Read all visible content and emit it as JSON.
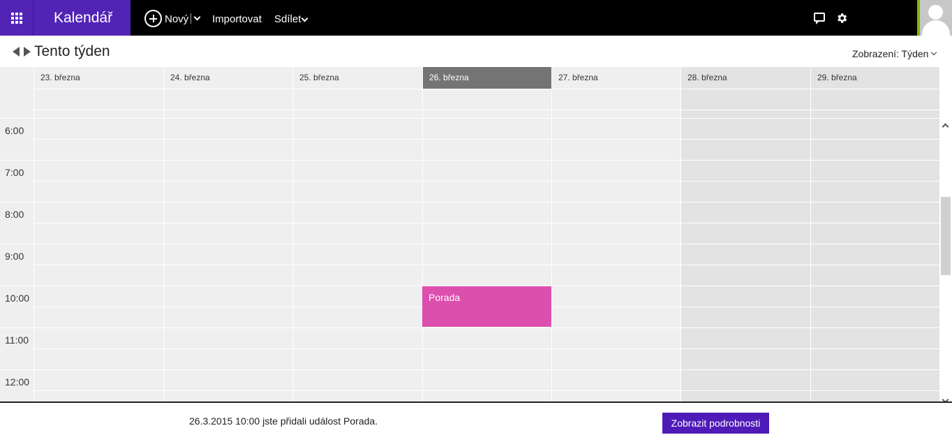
{
  "app": {
    "title": "Kalendář",
    "brand_color": "#5224b6",
    "waffle_icon": "waffle-icon"
  },
  "toolbar": {
    "new_label": "Nový",
    "import_label": "Importovat",
    "share_label": "Sdílet",
    "username": "          ",
    "icons": [
      "plus-circle-icon",
      "chat-icon",
      "gear-icon",
      "avatar"
    ]
  },
  "subheader": {
    "period_title": "Tento týden",
    "view_label": "Zobrazení: Týden"
  },
  "days": [
    {
      "label": "23. března",
      "today": false,
      "weekend": false
    },
    {
      "label": "24. března",
      "today": false,
      "weekend": false
    },
    {
      "label": "25. března",
      "today": false,
      "weekend": false
    },
    {
      "label": "26. března",
      "today": true,
      "weekend": false
    },
    {
      "label": "27. března",
      "today": false,
      "weekend": false
    },
    {
      "label": "28. března",
      "today": false,
      "weekend": true
    },
    {
      "label": "29. března",
      "today": false,
      "weekend": true
    }
  ],
  "hours": [
    "6:00",
    "7:00",
    "8:00",
    "9:00",
    "10:00",
    "11:00",
    "12:00"
  ],
  "events": [
    {
      "title": "Porada",
      "day": "26. března",
      "time": "10:00",
      "color": "#dc4fad"
    }
  ],
  "notification": {
    "text": "26.3.2015 10:00 jste přidali událost Porada.",
    "button_label": "Zobrazit podrobnosti",
    "button_color": "#4f1bb8"
  }
}
